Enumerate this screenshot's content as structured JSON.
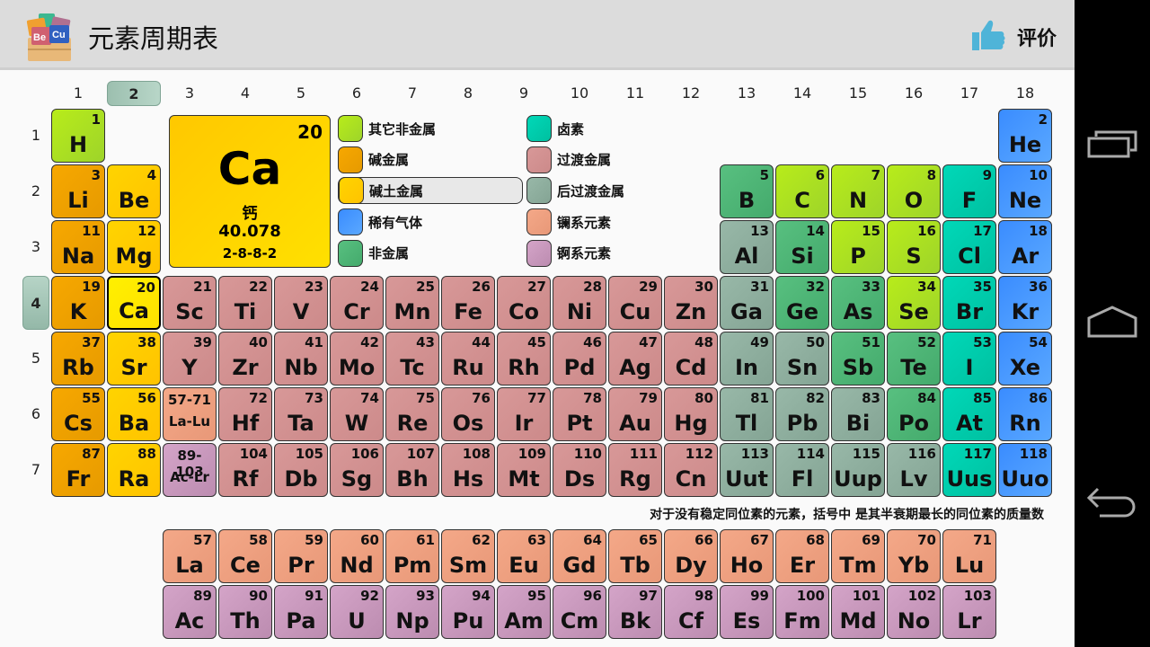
{
  "header": {
    "title": "元素周期表",
    "rate_label": "评价"
  },
  "groups": [
    "1",
    "2",
    "3",
    "4",
    "5",
    "6",
    "7",
    "8",
    "9",
    "10",
    "11",
    "12",
    "13",
    "14",
    "15",
    "16",
    "17",
    "18"
  ],
  "selected_group": "2",
  "periods": [
    "1",
    "2",
    "3",
    "4",
    "5",
    "6",
    "7"
  ],
  "selected_period": "4",
  "detail": {
    "number": "20",
    "symbol": "Ca",
    "name": "钙",
    "mass": "40.078",
    "config": "2-8-8-2"
  },
  "legend": [
    {
      "label": "其它非金属",
      "cat": "on"
    },
    {
      "label": "碱金属",
      "cat": "am"
    },
    {
      "label": "碱土金属",
      "cat": "ae",
      "selected": true
    },
    {
      "label": "稀有气体",
      "cat": "ng"
    },
    {
      "label": "非金属",
      "cat": "nm"
    },
    {
      "label": "卤素",
      "cat": "ha"
    },
    {
      "label": "过渡金属",
      "cat": "tm"
    },
    {
      "label": "后过渡金属",
      "cat": "pt"
    },
    {
      "label": "镧系元素",
      "cat": "ln"
    },
    {
      "label": "锕系元素",
      "cat": "ac"
    }
  ],
  "note": "对于没有稳定同位素的元素，括号中 是其半衰期最长的同位素的质量数",
  "colors": {
    "header_bg": "#dcdcdc",
    "thumb": "#4fb4d8",
    "selected_group": "#a8ccbc"
  },
  "elements": [
    [
      "H",
      "1",
      1,
      1,
      "on"
    ],
    [
      "He",
      "2",
      18,
      1,
      "ng"
    ],
    [
      "Li",
      "3",
      1,
      2,
      "am"
    ],
    [
      "Be",
      "4",
      2,
      2,
      "ae"
    ],
    [
      "B",
      "5",
      13,
      2,
      "nm"
    ],
    [
      "C",
      "6",
      14,
      2,
      "on"
    ],
    [
      "N",
      "7",
      15,
      2,
      "on"
    ],
    [
      "O",
      "8",
      16,
      2,
      "on"
    ],
    [
      "F",
      "9",
      17,
      2,
      "ha"
    ],
    [
      "Ne",
      "10",
      18,
      2,
      "ng"
    ],
    [
      "Na",
      "11",
      1,
      3,
      "am"
    ],
    [
      "Mg",
      "12",
      2,
      3,
      "ae"
    ],
    [
      "Al",
      "13",
      13,
      3,
      "pt"
    ],
    [
      "Si",
      "14",
      14,
      3,
      "nm"
    ],
    [
      "P",
      "15",
      15,
      3,
      "on"
    ],
    [
      "S",
      "16",
      16,
      3,
      "on"
    ],
    [
      "Cl",
      "17",
      17,
      3,
      "ha"
    ],
    [
      "Ar",
      "18",
      18,
      3,
      "ng"
    ],
    [
      "K",
      "19",
      1,
      4,
      "am"
    ],
    [
      "Ca",
      "20",
      2,
      4,
      "ae sel"
    ],
    [
      "Sc",
      "21",
      3,
      4,
      "tm"
    ],
    [
      "Ti",
      "22",
      4,
      4,
      "tm"
    ],
    [
      "V",
      "23",
      5,
      4,
      "tm"
    ],
    [
      "Cr",
      "24",
      6,
      4,
      "tm"
    ],
    [
      "Mn",
      "25",
      7,
      4,
      "tm"
    ],
    [
      "Fe",
      "26",
      8,
      4,
      "tm"
    ],
    [
      "Co",
      "27",
      9,
      4,
      "tm"
    ],
    [
      "Ni",
      "28",
      10,
      4,
      "tm"
    ],
    [
      "Cu",
      "29",
      11,
      4,
      "tm"
    ],
    [
      "Zn",
      "30",
      12,
      4,
      "tm"
    ],
    [
      "Ga",
      "31",
      13,
      4,
      "pt"
    ],
    [
      "Ge",
      "32",
      14,
      4,
      "nm"
    ],
    [
      "As",
      "33",
      15,
      4,
      "nm"
    ],
    [
      "Se",
      "34",
      16,
      4,
      "on"
    ],
    [
      "Br",
      "35",
      17,
      4,
      "ha"
    ],
    [
      "Kr",
      "36",
      18,
      4,
      "ng"
    ],
    [
      "Rb",
      "37",
      1,
      5,
      "am"
    ],
    [
      "Sr",
      "38",
      2,
      5,
      "ae"
    ],
    [
      "Y",
      "39",
      3,
      5,
      "tm"
    ],
    [
      "Zr",
      "40",
      4,
      5,
      "tm"
    ],
    [
      "Nb",
      "41",
      5,
      5,
      "tm"
    ],
    [
      "Mo",
      "42",
      6,
      5,
      "tm"
    ],
    [
      "Tc",
      "43",
      7,
      5,
      "tm"
    ],
    [
      "Ru",
      "44",
      8,
      5,
      "tm"
    ],
    [
      "Rh",
      "45",
      9,
      5,
      "tm"
    ],
    [
      "Pd",
      "46",
      10,
      5,
      "tm"
    ],
    [
      "Ag",
      "47",
      11,
      5,
      "tm"
    ],
    [
      "Cd",
      "48",
      12,
      5,
      "tm"
    ],
    [
      "In",
      "49",
      13,
      5,
      "pt"
    ],
    [
      "Sn",
      "50",
      14,
      5,
      "pt"
    ],
    [
      "Sb",
      "51",
      15,
      5,
      "nm"
    ],
    [
      "Te",
      "52",
      16,
      5,
      "nm"
    ],
    [
      "I",
      "53",
      17,
      5,
      "ha"
    ],
    [
      "Xe",
      "54",
      18,
      5,
      "ng"
    ],
    [
      "Cs",
      "55",
      1,
      6,
      "am"
    ],
    [
      "Ba",
      "56",
      2,
      6,
      "ae"
    ],
    [
      "La-Lu",
      "57-71",
      3,
      6,
      "ln range"
    ],
    [
      "Hf",
      "72",
      4,
      6,
      "tm"
    ],
    [
      "Ta",
      "73",
      5,
      6,
      "tm"
    ],
    [
      "W",
      "74",
      6,
      6,
      "tm"
    ],
    [
      "Re",
      "75",
      7,
      6,
      "tm"
    ],
    [
      "Os",
      "76",
      8,
      6,
      "tm"
    ],
    [
      "Ir",
      "77",
      9,
      6,
      "tm"
    ],
    [
      "Pt",
      "78",
      10,
      6,
      "tm"
    ],
    [
      "Au",
      "79",
      11,
      6,
      "tm"
    ],
    [
      "Hg",
      "80",
      12,
      6,
      "tm"
    ],
    [
      "Tl",
      "81",
      13,
      6,
      "pt"
    ],
    [
      "Pb",
      "82",
      14,
      6,
      "pt"
    ],
    [
      "Bi",
      "83",
      15,
      6,
      "pt"
    ],
    [
      "Po",
      "84",
      16,
      6,
      "nm"
    ],
    [
      "At",
      "85",
      17,
      6,
      "ha"
    ],
    [
      "Rn",
      "86",
      18,
      6,
      "ng"
    ],
    [
      "Fr",
      "87",
      1,
      7,
      "am"
    ],
    [
      "Ra",
      "88",
      2,
      7,
      "ae"
    ],
    [
      "Ac-Lr",
      "89-103",
      3,
      7,
      "ac range"
    ],
    [
      "Rf",
      "104",
      4,
      7,
      "tm"
    ],
    [
      "Db",
      "105",
      5,
      7,
      "tm"
    ],
    [
      "Sg",
      "106",
      6,
      7,
      "tm"
    ],
    [
      "Bh",
      "107",
      7,
      7,
      "tm"
    ],
    [
      "Hs",
      "108",
      8,
      7,
      "tm"
    ],
    [
      "Mt",
      "109",
      9,
      7,
      "tm"
    ],
    [
      "Ds",
      "110",
      10,
      7,
      "tm"
    ],
    [
      "Rg",
      "111",
      11,
      7,
      "tm"
    ],
    [
      "Cn",
      "112",
      12,
      7,
      "tm"
    ],
    [
      "Uut",
      "113",
      13,
      7,
      "pt"
    ],
    [
      "Fl",
      "114",
      14,
      7,
      "pt"
    ],
    [
      "Uup",
      "115",
      15,
      7,
      "pt"
    ],
    [
      "Lv",
      "116",
      16,
      7,
      "pt"
    ],
    [
      "Uus",
      "117",
      17,
      7,
      "ha"
    ],
    [
      "Uuo",
      "118",
      18,
      7,
      "ng"
    ],
    [
      "La",
      "57",
      3,
      9,
      "ln"
    ],
    [
      "Ce",
      "58",
      4,
      9,
      "ln"
    ],
    [
      "Pr",
      "59",
      5,
      9,
      "ln"
    ],
    [
      "Nd",
      "60",
      6,
      9,
      "ln"
    ],
    [
      "Pm",
      "61",
      7,
      9,
      "ln"
    ],
    [
      "Sm",
      "62",
      8,
      9,
      "ln"
    ],
    [
      "Eu",
      "63",
      9,
      9,
      "ln"
    ],
    [
      "Gd",
      "64",
      10,
      9,
      "ln"
    ],
    [
      "Tb",
      "65",
      11,
      9,
      "ln"
    ],
    [
      "Dy",
      "66",
      12,
      9,
      "ln"
    ],
    [
      "Ho",
      "67",
      13,
      9,
      "ln"
    ],
    [
      "Er",
      "68",
      14,
      9,
      "ln"
    ],
    [
      "Tm",
      "69",
      15,
      9,
      "ln"
    ],
    [
      "Yb",
      "70",
      16,
      9,
      "ln"
    ],
    [
      "Lu",
      "71",
      17,
      9,
      "ln"
    ],
    [
      "Ac",
      "89",
      3,
      10,
      "ac"
    ],
    [
      "Th",
      "90",
      4,
      10,
      "ac"
    ],
    [
      "Pa",
      "91",
      5,
      10,
      "ac"
    ],
    [
      "U",
      "92",
      6,
      10,
      "ac"
    ],
    [
      "Np",
      "93",
      7,
      10,
      "ac"
    ],
    [
      "Pu",
      "94",
      8,
      10,
      "ac"
    ],
    [
      "Am",
      "95",
      9,
      10,
      "ac"
    ],
    [
      "Cm",
      "96",
      10,
      10,
      "ac"
    ],
    [
      "Bk",
      "97",
      11,
      10,
      "ac"
    ],
    [
      "Cf",
      "98",
      12,
      10,
      "ac"
    ],
    [
      "Es",
      "99",
      13,
      10,
      "ac"
    ],
    [
      "Fm",
      "100",
      14,
      10,
      "ac"
    ],
    [
      "Md",
      "101",
      15,
      10,
      "ac"
    ],
    [
      "No",
      "102",
      16,
      10,
      "ac"
    ],
    [
      "Lr",
      "103",
      17,
      10,
      "ac"
    ]
  ]
}
